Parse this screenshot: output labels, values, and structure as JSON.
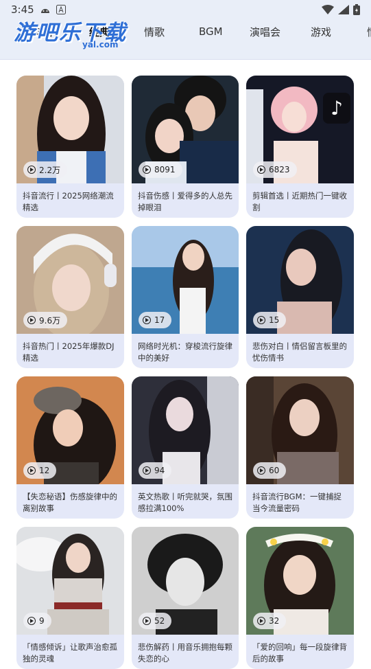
{
  "status": {
    "time": "3:45"
  },
  "watermark": {
    "text": "游吧乐下载",
    "sub": "yal.com"
  },
  "tabs": [
    "抖音",
    "经典",
    "情歌",
    "BGM",
    "演唱会",
    "游戏",
    "情"
  ],
  "colors": {
    "header_bg": "#e9eef8",
    "card_bg": "#e4e8f8",
    "accent": "#2f6fd6"
  },
  "cards": [
    {
      "count": "2.2万",
      "title": "抖音流行丨2025网络潮流精选"
    },
    {
      "count": "8091",
      "title": "抖音伤感丨爱得多的人总先掉眼泪"
    },
    {
      "count": "6823",
      "title": "剪辑首选丨近期热门一键收割"
    },
    {
      "count": "9.6万",
      "title": "抖音热门丨2025年爆款DJ精选"
    },
    {
      "count": "17",
      "title": "网络时光机：穿梭流行旋律中的美好"
    },
    {
      "count": "15",
      "title": "悲伤对白丨情侣留言板里的忧伤情书"
    },
    {
      "count": "12",
      "title": "【失恋秘语】伤感旋律中的离别故事"
    },
    {
      "count": "94",
      "title": "英文热歌丨听完就哭，氛围感拉满100%"
    },
    {
      "count": "60",
      "title": "抖音流行BGM：一键捕捉当今流量密码"
    },
    {
      "count": "9",
      "title": "「情感倾诉」让歌声治愈孤独的灵魂"
    },
    {
      "count": "52",
      "title": "悲伤解药丨用音乐拥抱每颗失恋的心"
    },
    {
      "count": "32",
      "title": "「爱的回响」每一段旋律背后的故事"
    }
  ]
}
